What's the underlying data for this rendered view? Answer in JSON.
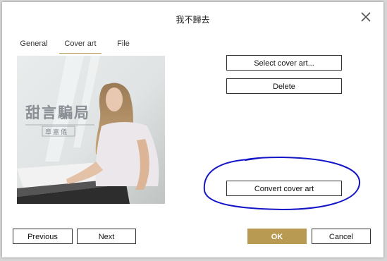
{
  "dialog": {
    "title": "我不歸去",
    "close_icon": "close-icon"
  },
  "tabs": [
    {
      "label": "General",
      "active": false
    },
    {
      "label": "Cover art",
      "active": true
    },
    {
      "label": "File",
      "active": false
    }
  ],
  "cover_art": {
    "title_text": "甜言騙局",
    "artist_text": "章嘉儀"
  },
  "actions": {
    "select_label": "Select cover art...",
    "delete_label": "Delete",
    "convert_label": "Convert cover art"
  },
  "footer": {
    "previous_label": "Previous",
    "next_label": "Next",
    "ok_label": "OK",
    "cancel_label": "Cancel"
  },
  "colors": {
    "accent": "#b99a52",
    "annotation": "#1515c8"
  }
}
